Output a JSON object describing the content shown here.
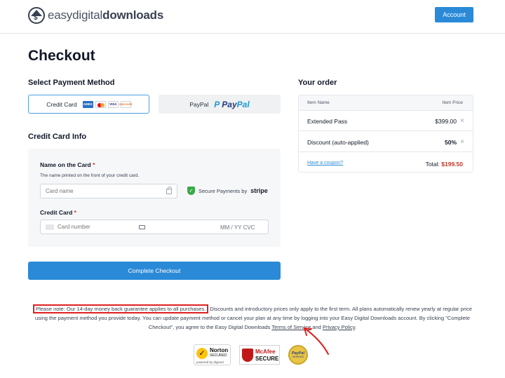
{
  "header": {
    "logo_mark": "$",
    "logo_part1": "easy",
    "logo_part2": "digital",
    "logo_part3": "downloads",
    "account_label": "Account"
  },
  "page_title": "Checkout",
  "payment": {
    "section_title": "Select Payment Method",
    "credit_card_label": "Credit Card",
    "card_logos": [
      "AMEX",
      "MC",
      "VISA",
      "DISCOVER"
    ],
    "paypal_label": "PayPal",
    "paypal_logo_a": "Pay",
    "paypal_logo_b": "Pal"
  },
  "cc_info": {
    "section_title": "Credit Card Info",
    "name_label": "Name on the Card",
    "required_mark": "*",
    "name_desc": "The name printed on the front of your credit card.",
    "name_placeholder": "Card name",
    "secure_text": "Secure Payments by",
    "secure_brand": "stripe",
    "card_label": "Credit Card",
    "card_placeholder": "Card number",
    "expiry_cvc": "MM / YY  CVC"
  },
  "checkout_button": "Complete Checkout",
  "order": {
    "section_title": "Your order",
    "col_item": "Item Name",
    "col_price": "Item Price",
    "rows": [
      {
        "name": "Extended Pass",
        "price": "$399.00"
      },
      {
        "name": "Discount (auto-applied)",
        "price": "50%"
      }
    ],
    "remove_glyph": "×",
    "coupon_link": "Have a coupon?",
    "total_label": "Total:",
    "total_value": "$199.50"
  },
  "notice": {
    "highlighted": "Please note: Our 14-day money back guarantee applies to all purchases.",
    "rest": " Discounts and introductory prices only apply to the first term. All plans automatically renew yearly at regular price using the payment method you provide today. You can update payment method or cancel your plan at any time by logging into your Easy Digital Downloads account. By clicking \"Complete Checkout\", you agree to the Easy Digital Downloads ",
    "tos_link": "Terms of Service",
    "and": " and ",
    "privacy_link": "Privacy Policy",
    "end": "."
  },
  "badges": {
    "norton_1": "Norton",
    "norton_2": "SECURED",
    "norton_3": "powered by digicert",
    "mcafee_1": "McAfee",
    "mcafee_2": "SECURE",
    "paypal_1": "PayPal",
    "paypal_2": "VERIFIED"
  },
  "colors": {
    "primary": "#2a8ad7",
    "accent_red": "#c0392b",
    "annotation": "#e02020"
  }
}
